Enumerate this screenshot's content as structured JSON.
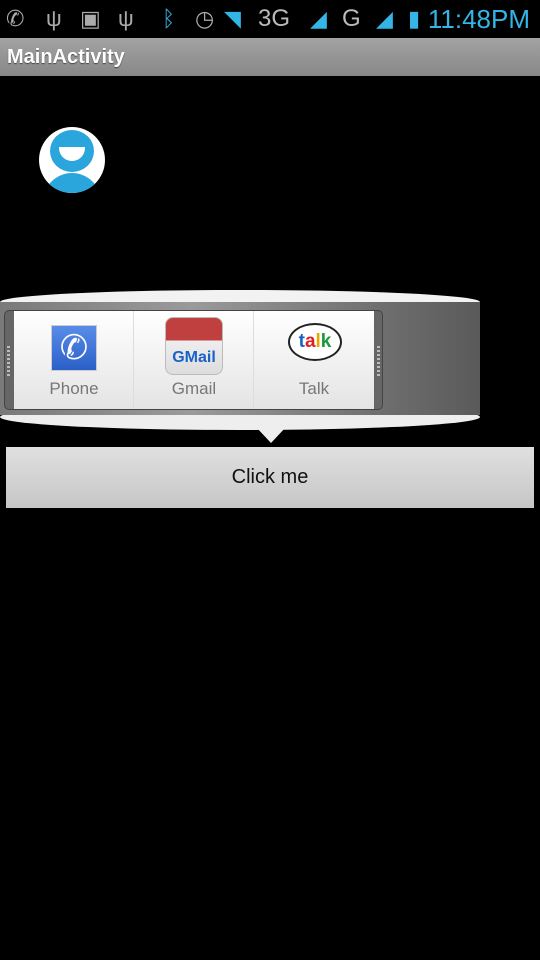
{
  "status_bar": {
    "time": "11:48PM",
    "network_1": "3G",
    "network_2": "G",
    "icons": [
      "phone-bluetooth-icon",
      "usb-icon",
      "android-debug-icon",
      "usb-icon",
      "bluetooth-icon",
      "alarm-icon",
      "wifi-icon",
      "signal-icon",
      "signal-icon",
      "battery-charging-icon"
    ]
  },
  "action_bar": {
    "title": "MainActivity"
  },
  "avatar": {
    "icon": "user-avatar-icon",
    "color": "#2ba6dc"
  },
  "share_popup": {
    "items": [
      {
        "label": "Phone",
        "icon": "phone-icon"
      },
      {
        "label": "Gmail",
        "icon": "gmail-icon",
        "icon_text": "GMail"
      },
      {
        "label": "Talk",
        "icon": "talk-icon",
        "icon_text": "talk"
      }
    ]
  },
  "button": {
    "label": "Click me"
  }
}
